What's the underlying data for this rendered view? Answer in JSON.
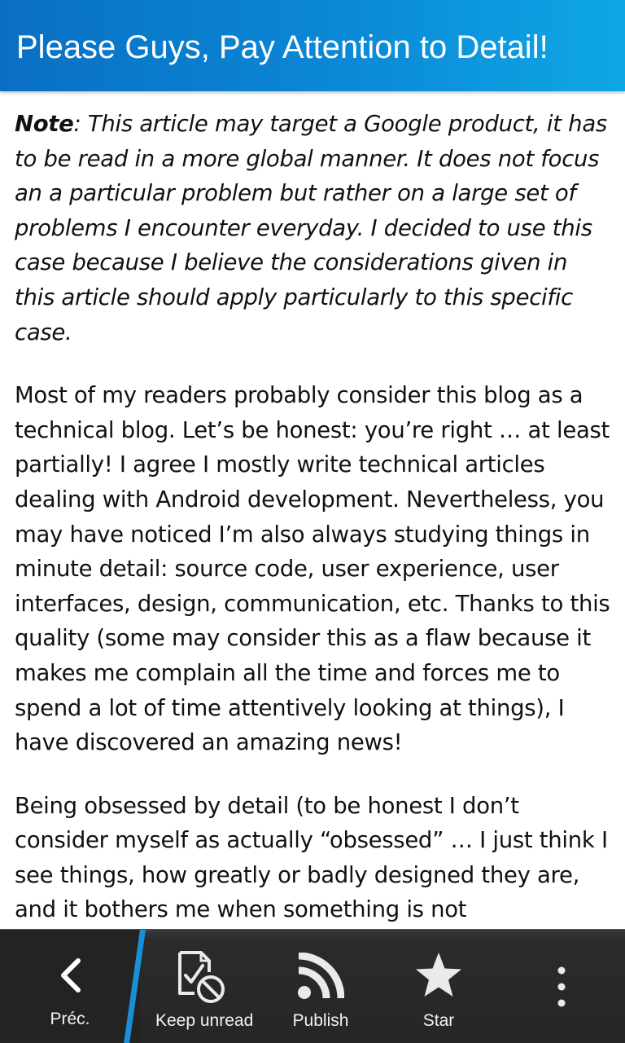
{
  "header": {
    "title": "Please Guys, Pay Attention to Detail!"
  },
  "article": {
    "note_label": "Note",
    "note_text": ": This article may target a Google product, it has to be read in a more global manner. It does not focus an a particular problem but rather on a large set of problems I encounter everyday. I decided to use this case because I believe the considerations given in this article should apply particularly to this specific case.",
    "paragraph_1": "Most of my readers probably consider this blog as a technical blog. Let’s be honest: you’re right … at least partially! I agree I mostly write technical articles dealing with Android development. Nevertheless, you may have noticed I’m also always studying things in minute detail: source code, user experience, user interfaces, design, communication, etc. Thanks to this quality (some may consider this as a flaw because it makes me complain all the time and forces me to spend a lot of time attentively looking at things), I have discovered an amazing news!",
    "paragraph_2": "Being obsessed by detail (to be honest I don’t consider myself as actually “obsessed” … I just think I see things, how greatly or badly designed they are, and it bothers me when something is not"
  },
  "action_bar": {
    "back_label": "Préc.",
    "keep_unread_label": "Keep unread",
    "publish_label": "Publish",
    "star_label": "Star"
  },
  "colors": {
    "title_bar_start": "#0a6fc2",
    "title_bar_end": "#0ea7e6",
    "action_bar_bg": "#262626",
    "accent_blue": "#1a8fd8"
  },
  "icons": {
    "back": "chevron-left-icon",
    "keep_unread": "document-check-blocked-icon",
    "publish": "rss-feed-icon",
    "star": "star-icon",
    "overflow": "overflow-menu-icon"
  }
}
